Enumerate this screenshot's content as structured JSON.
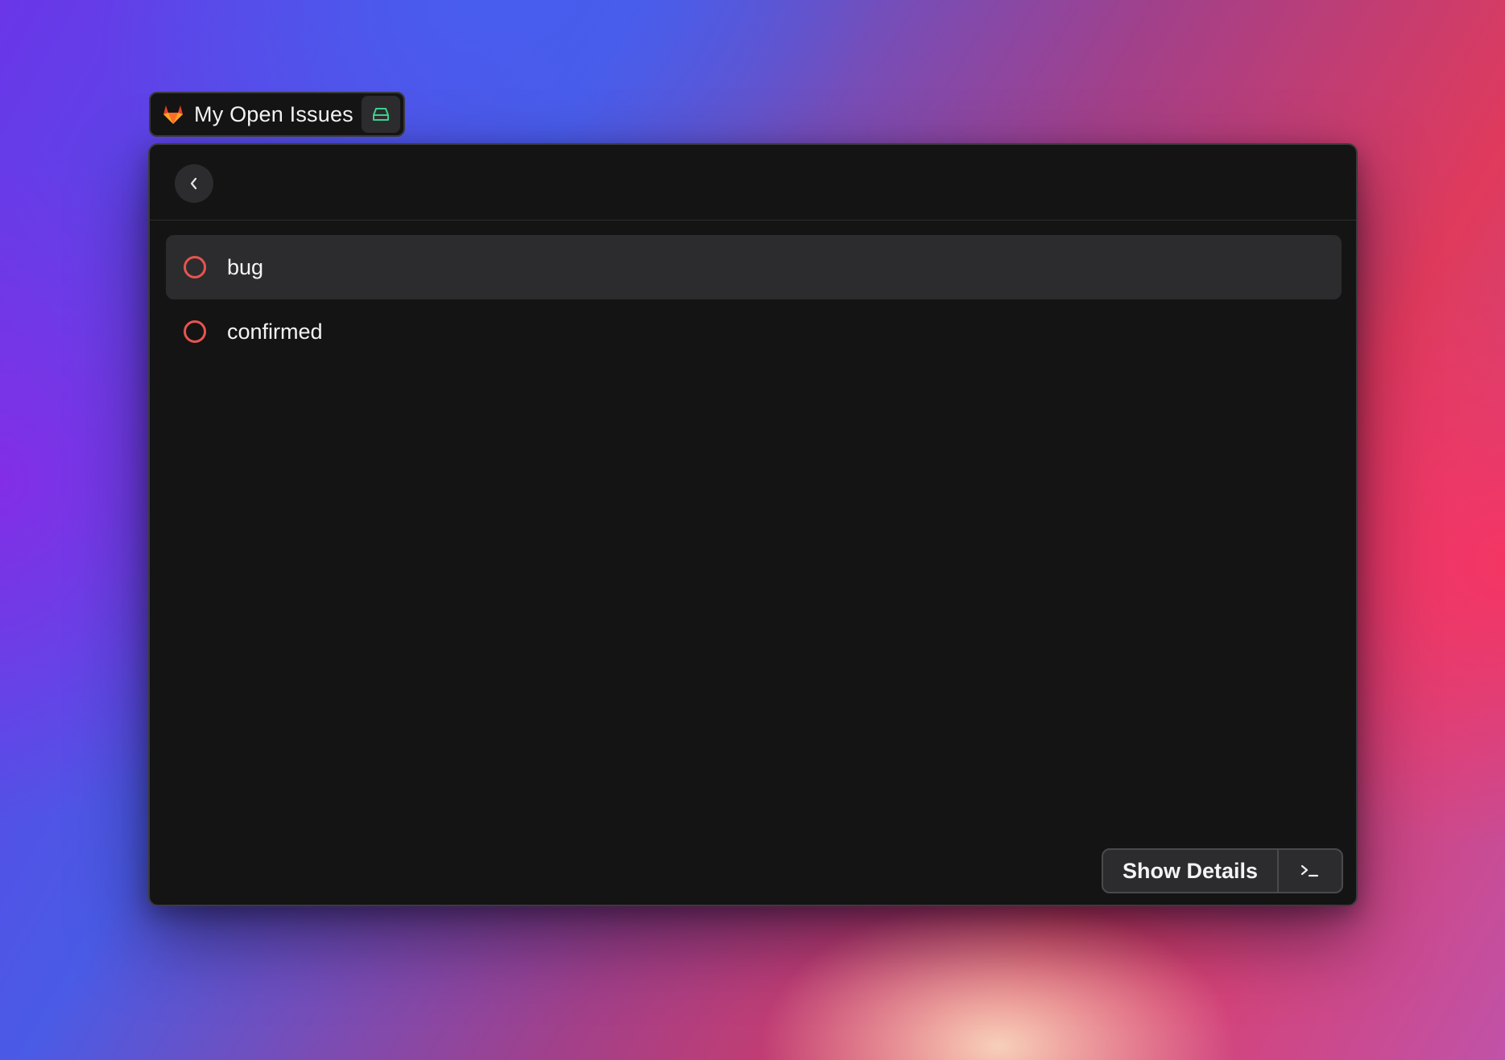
{
  "command": {
    "title": "My Open Issues",
    "logo_icon": "gitlab-icon",
    "accessory_icon": "inbox-icon"
  },
  "navigation": {
    "back_icon": "chevron-left-icon"
  },
  "list": {
    "items": [
      {
        "label": "bug",
        "icon": "open-issue-circle-icon",
        "icon_color": "#e5554f",
        "selected": true
      },
      {
        "label": "confirmed",
        "icon": "open-issue-circle-icon",
        "icon_color": "#e5554f",
        "selected": false
      }
    ]
  },
  "actions": {
    "primary_label": "Show Details",
    "secondary_icon": "terminal-icon"
  },
  "colors": {
    "window_background": "#141414",
    "selected_row": "#2c2c2e",
    "issue_open": "#e5554f",
    "accessory_green": "#3ecf8e"
  }
}
